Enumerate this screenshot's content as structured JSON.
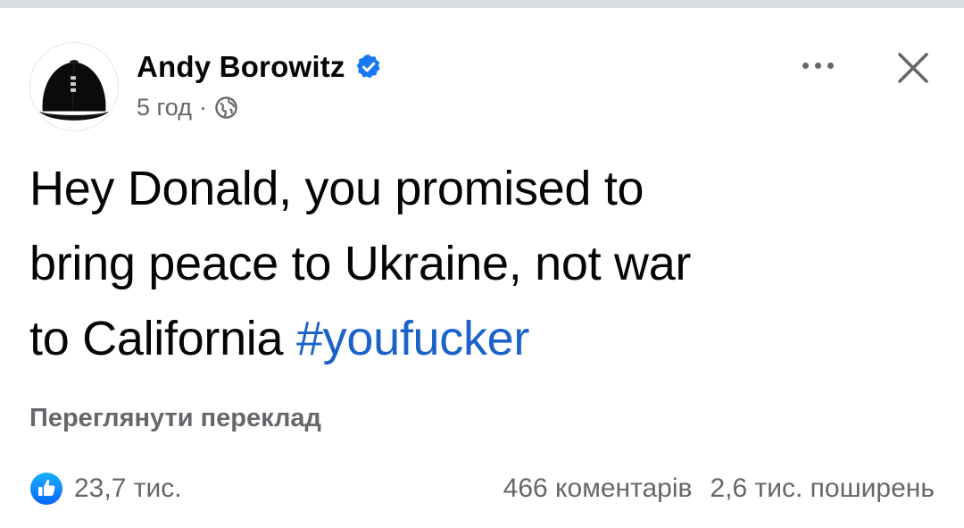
{
  "post": {
    "author": {
      "name": "Andy Borowitz",
      "verified": true,
      "avatar_icon": "black-baseball-cap-avatar"
    },
    "meta": {
      "time": "5 год",
      "separator": "·",
      "audience_icon": "globe-icon"
    },
    "text_lines": [
      "Hey Donald, you promised to",
      "bring peace to Ukraine, not war",
      "to California"
    ],
    "hashtag": "#youfucker",
    "translate_link": "Переглянути переклад",
    "reactions": {
      "icon": "like-icon",
      "count": "23,7 тис."
    },
    "comments": "466 коментарів",
    "shares": "2,6 тис. поширень"
  },
  "colors": {
    "text_primary": "#050505",
    "text_secondary": "#65676b",
    "link": "#1c63c9",
    "verified_blue": "#1877f2",
    "top_strip": "#dadde1"
  },
  "icons": {
    "more": "more-dots-icon",
    "close": "close-icon",
    "verified": "verified-badge-icon"
  }
}
